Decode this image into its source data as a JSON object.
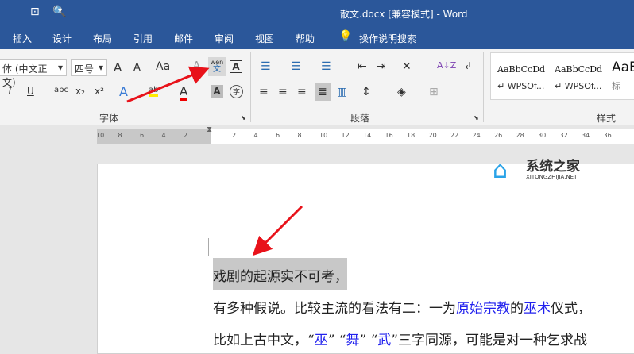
{
  "window": {
    "title": "散文.docx [兼容模式]  -  Word"
  },
  "quick_access": {
    "icons": [
      "touch-mode-icon",
      "print-preview-icon",
      "customize-icon"
    ]
  },
  "tabs": [
    "插入",
    "设计",
    "布局",
    "引用",
    "邮件",
    "审阅",
    "视图",
    "帮助"
  ],
  "tell_me": "操作说明搜索",
  "font": {
    "name": "体 (中文正文)",
    "size": "四号",
    "grow": "A",
    "shrink": "A",
    "case": "Aa",
    "clear": "A",
    "phonetic_top": "wén",
    "phonetic_bottom": "文",
    "border_char": "A",
    "italic": "I",
    "underline": "U",
    "strike": "abc",
    "sub": "x₂",
    "sup": "x²",
    "effects": "A",
    "highlight": "ab",
    "color": "A",
    "shade": "A",
    "enclose": "字",
    "group_label": "字体"
  },
  "paragraph": {
    "group_label": "段落",
    "sort": "A↓Z"
  },
  "styles": {
    "group_label": "样式",
    "items": [
      {
        "preview": "AaBbCcDd",
        "name": "↵ WPSOf..."
      },
      {
        "preview": "AaBbCcDd",
        "name": "↵ WPSOf..."
      },
      {
        "preview": "AaB",
        "name": "标"
      }
    ]
  },
  "ruler": {
    "left": [
      "10",
      "8",
      "6",
      "4",
      "2"
    ],
    "right": [
      "2",
      "4",
      "6",
      "8",
      "10",
      "12",
      "14",
      "16",
      "18",
      "20",
      "22",
      "24",
      "26",
      "28",
      "30",
      "32",
      "34",
      "36"
    ]
  },
  "watermark": {
    "name": "系统之家",
    "url": "XITONGZHIJIA.NET"
  },
  "document": {
    "line1": "戏剧的起源实不可考",
    "line1_end": "，",
    "line2_a": "有多种假说。比较主流的看法有二：一为",
    "line2_link1": "原始宗教",
    "line2_b": "的",
    "line2_link2": "巫术",
    "line2_c": "仪式，",
    "line3_a": "比如上古中文，“",
    "line3_q1": "巫",
    "line3_b": "” “",
    "line3_q2": "舞",
    "line3_c": "” “",
    "line3_q3": "武",
    "line3_d": "”三字同源，可能是对一种乞求战"
  },
  "colors": {
    "accent": "#2b579a",
    "arrow": "#e8121a",
    "link": "#2222ee",
    "highlight": "#c8c8c8"
  }
}
